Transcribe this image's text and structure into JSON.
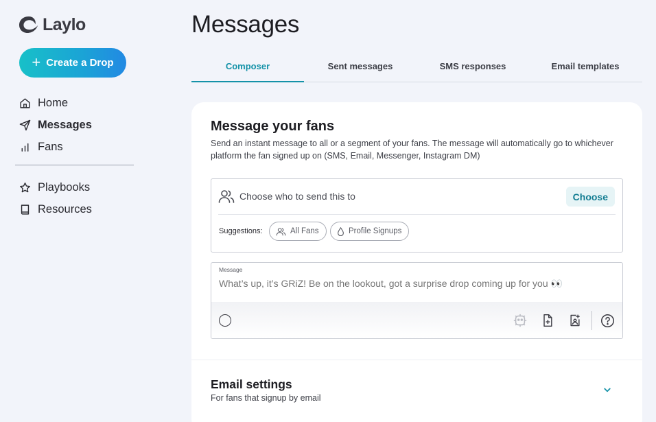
{
  "app": {
    "brand": "Laylo"
  },
  "sidebar": {
    "create_label": "Create a Drop",
    "items": [
      {
        "label": "Home",
        "icon": "home-icon"
      },
      {
        "label": "Messages",
        "icon": "send-icon"
      },
      {
        "label": "Fans",
        "icon": "bar-chart-icon"
      }
    ],
    "items2": [
      {
        "label": "Playbooks",
        "icon": "star-icon"
      },
      {
        "label": "Resources",
        "icon": "book-icon"
      }
    ]
  },
  "page": {
    "title": "Messages"
  },
  "tabs": [
    {
      "label": "Composer",
      "active": true
    },
    {
      "label": "Sent messages"
    },
    {
      "label": "SMS responses"
    },
    {
      "label": "Email templates"
    }
  ],
  "composer": {
    "title": "Message your fans",
    "description": "Send an instant message to all or a segment of your fans. The message will automatically go to whichever platform the fan signed up on (SMS, Email, Messenger, Instagram DM)",
    "recipient_placeholder": "Choose who to send this to",
    "choose_label": "Choose",
    "suggestions_label": "Suggestions:",
    "suggestions": [
      "All Fans",
      "Profile Signups"
    ],
    "message_label": "Message",
    "message_placeholder": "What’s up, it’s GRiZ! Be on the lookout, got a surprise drop coming up for you 👀"
  },
  "email_settings": {
    "title": "Email settings",
    "subtitle": "For fans that signup by email"
  },
  "colors": {
    "accent": "#1592a8",
    "gradient_start": "#18c0c8",
    "gradient_end": "#2289e3",
    "background": "#f2f4fa"
  }
}
